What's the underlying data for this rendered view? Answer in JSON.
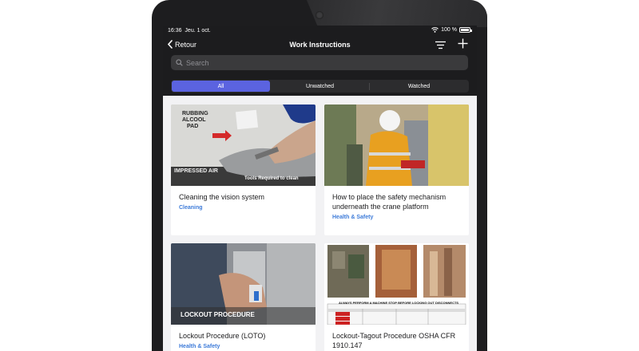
{
  "status_bar": {
    "time": "16:36",
    "date": "Jeu. 1 oct.",
    "battery": "100 %"
  },
  "nav": {
    "back_label": "Retour",
    "title": "Work Instructions"
  },
  "search": {
    "placeholder": "Search"
  },
  "segments": [
    {
      "label": "All",
      "selected": true
    },
    {
      "label": "Unwatched",
      "selected": false
    },
    {
      "label": "Watched",
      "selected": false
    }
  ],
  "cards": [
    {
      "title": "Cleaning the vision system",
      "category": "Cleaning",
      "image_text": [
        "RUBBING",
        "ALCOOL",
        "PAD",
        "IMPRESSED AIR",
        "Tools Required to clean"
      ]
    },
    {
      "title": "How to place the safety mechanism underneath the crane platform",
      "category": "Health & Safety"
    },
    {
      "title": "Lockout Procedure (LOTO)",
      "category": "Health & Safety",
      "image_text": [
        "LOCKOUT PROCEDURE"
      ]
    },
    {
      "title": "Lockout-Tagout Procedure OSHA CFR 1910.147",
      "category": "",
      "image_text": [
        "ALWAYS PERFORM A MACHINE STOP BEFORE LOCKING OUT DISCONNECTS"
      ]
    }
  ],
  "colors": {
    "accent": "#5b63e0",
    "category": "#3d7bd9",
    "topbar": "#1c1c1e",
    "bezel": "#1d1d1f"
  }
}
